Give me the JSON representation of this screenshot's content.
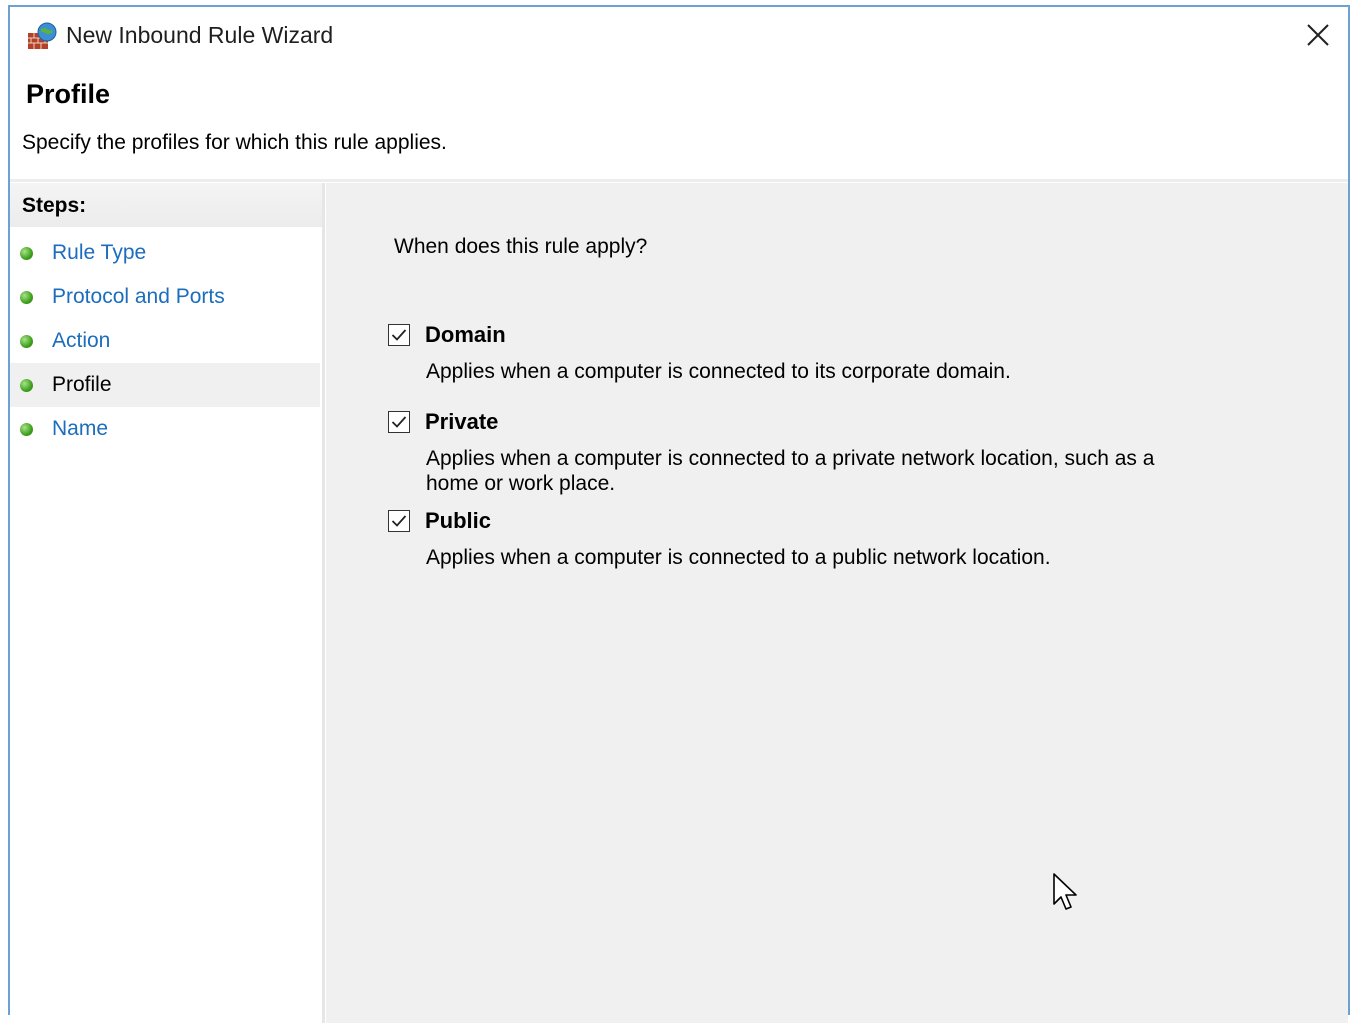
{
  "window": {
    "title": "New Inbound Rule Wizard"
  },
  "header": {
    "heading": "Profile",
    "description": "Specify the profiles for which this rule applies."
  },
  "steps": {
    "title": "Steps:",
    "items": [
      {
        "label": "Rule Type",
        "active": false
      },
      {
        "label": "Protocol and Ports",
        "active": false
      },
      {
        "label": "Action",
        "active": false
      },
      {
        "label": "Profile",
        "active": true
      },
      {
        "label": "Name",
        "active": false
      }
    ]
  },
  "main": {
    "question": "When does this rule apply?",
    "options": [
      {
        "label": "Domain",
        "checked": true,
        "description": "Applies when a computer is connected to its corporate domain."
      },
      {
        "label": "Private",
        "checked": true,
        "description": "Applies when a computer is connected to a private network location, such as a home or work place."
      },
      {
        "label": "Public",
        "checked": true,
        "description": "Applies when a computer is connected to a public network location."
      }
    ]
  },
  "colors": {
    "step_link": "#1c6dbd",
    "window_border": "#6fa0d2",
    "content_bg": "#f0f0f0",
    "step_dot": "#3ea01c"
  },
  "icons": {
    "app": "firewall-icon",
    "close": "close-icon",
    "step_bullet": "green-dot-icon",
    "check": "checkmark-icon",
    "cursor": "mouse-cursor-icon"
  }
}
